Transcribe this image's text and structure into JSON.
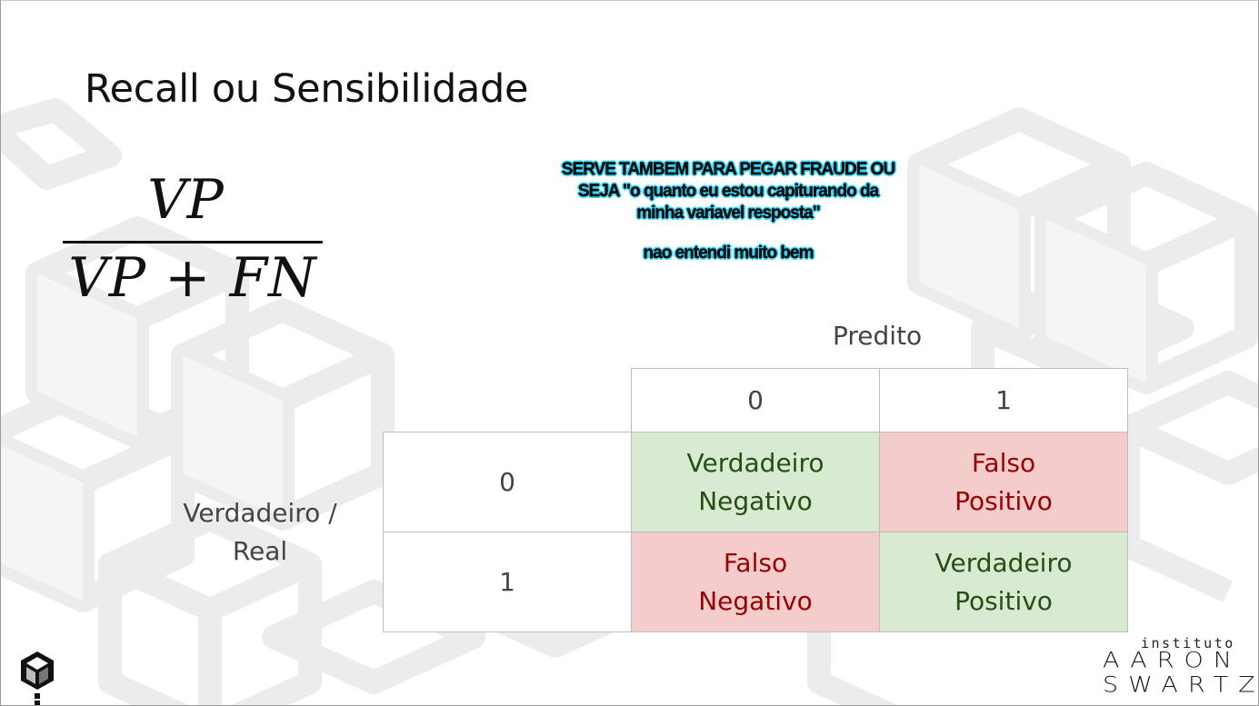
{
  "slide": {
    "title": "Recall ou Sensibilidade",
    "formula": {
      "numerator": "VP",
      "denominator": "VP + FN"
    },
    "annotation": {
      "line1": "SERVE TAMBEM PARA PEGAR FRAUDE OU",
      "line2": "SEJA \"o quanto eu estou capiturando da",
      "line3": "minha variavel resposta\"",
      "line4": "nao entendi muito bem"
    },
    "matrix": {
      "predicted_label": "Predito",
      "actual_label": "Verdadeiro / Real",
      "col_headers": [
        "0",
        "1"
      ],
      "row_headers": [
        "0",
        "1"
      ],
      "cells": [
        [
          "Verdadeiro Negativo",
          "Falso Positivo"
        ],
        [
          "Falso Negativo",
          "Verdadeiro Positivo"
        ]
      ],
      "colors": {
        "true_bg": "#d9ead3",
        "true_text": "#274e13",
        "false_bg": "#f4cccc",
        "false_text": "#990000"
      }
    },
    "logo": {
      "small": "instituto",
      "line1": "AARON",
      "line2": "SWARTZ"
    }
  }
}
